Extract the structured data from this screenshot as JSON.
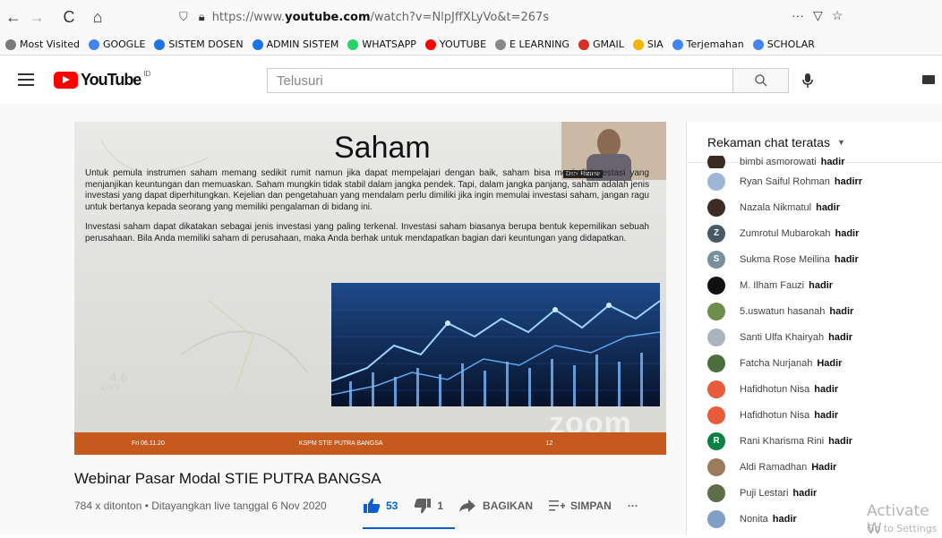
{
  "browser": {
    "back": "←",
    "forward": "→",
    "reload": "C",
    "home": "⌂",
    "url_prefix": "https://www.",
    "url_domain": "youtube.com",
    "url_suffix": "/watch?v=NlpJffXLyVo&t=267s",
    "menu": "···",
    "pocket": "▽",
    "star": "☆"
  },
  "bookmarks": [
    {
      "label": "Most Visited",
      "color": "#7a7a7a"
    },
    {
      "label": "GOOGLE",
      "color": "#4285f4"
    },
    {
      "label": "SISTEM DOSEN",
      "color": "#1a73e8"
    },
    {
      "label": "ADMIN SISTEM",
      "color": "#1a73e8"
    },
    {
      "label": "WHATSAPP",
      "color": "#25d366"
    },
    {
      "label": "YOUTUBE",
      "color": "#ff0000"
    },
    {
      "label": "E LEARNING",
      "color": "#888888"
    },
    {
      "label": "GMAIL",
      "color": "#d93025"
    },
    {
      "label": "SIA",
      "color": "#f4b400"
    },
    {
      "label": "Terjemahan",
      "color": "#4285f4"
    },
    {
      "label": "SCHOLAR",
      "color": "#4285f4"
    }
  ],
  "youtube": {
    "logo_text": "YouTube",
    "logo_region": "ID",
    "search_placeholder": "Telusuri"
  },
  "video": {
    "slide_title": "Saham",
    "slide_p1": "Untuk pemula instrumen saham memang sedikit rumit namun jika dapat mempelajari dengan baik, saham bisa menjadi investasi yang menjanjikan keuntungan dan memuaskan. Saham mungkin tidak stabil dalam jangka pendek. Tapi, dalam jangka panjang, saham adalah jenis investasi yang dapat diperhitungkan. Kejelian dan pengetahuan yang mendalam perlu dimiliki jika ingin memulai investasi saham, jangan ragu untuk bertanya kepada seorang yang memiliki pengalaman di bidang ini.",
    "slide_p2": "Investasi saham dapat dikatakan sebagai jenis investasi yang paling terkenal. Investasi saham biasanya berupa bentuk kepemilikan sebuah perusahaan. Bila Anda memiliki saham di perusahaan, maka Anda berhak untuk mendapatkan bagian dari keuntungan yang didapatkan.",
    "webcam_name": "Dani Rizana",
    "zoom_watermark": "zoom",
    "footer_date": "Fri 06.11.20",
    "footer_center": "KSPM STIE PUTRA BANGSA",
    "footer_page": "12",
    "title": "Webinar Pasar Modal STIE PUTRA BANGSA",
    "meta": "784 x ditonton • Ditayangkan live tanggal 6 Nov 2020",
    "likes": "53",
    "dislikes": "1",
    "share": "BAGIKAN",
    "save": "SIMPAN",
    "more": "···"
  },
  "chat": {
    "header": "Rekaman chat teratas",
    "items": [
      {
        "author": "bimbi asmorowati",
        "msg": "hadir",
        "avatar_color": "#3b2a22",
        "avatar_text": ""
      },
      {
        "author": "Ryan Saiful Rohman",
        "msg": "hadirr",
        "avatar_color": "#9fb6d8",
        "avatar_text": ""
      },
      {
        "author": "Nazala Nikmatul",
        "msg": "hadir",
        "avatar_color": "#3d2b24",
        "avatar_text": ""
      },
      {
        "author": "Zumrotul Mubarokah",
        "msg": "hadir",
        "avatar_color": "#455a64",
        "avatar_text": "Z"
      },
      {
        "author": "Sukma Rose Meilina",
        "msg": "hadir",
        "avatar_color": "#78909c",
        "avatar_text": "S"
      },
      {
        "author": "M. Ilham Fauzi",
        "msg": "hadir",
        "avatar_color": "#111111",
        "avatar_text": ""
      },
      {
        "author": "5.uswatun hasanah",
        "msg": "hadir",
        "avatar_color": "#6b8f4a",
        "avatar_text": ""
      },
      {
        "author": "Santi Ulfa Khairyah",
        "msg": "hadir",
        "avatar_color": "#a9b4bf",
        "avatar_text": ""
      },
      {
        "author": "Fatcha Nurjanah",
        "msg": "Hadir",
        "avatar_color": "#4b6e3c",
        "avatar_text": ""
      },
      {
        "author": "Hafidhotun Nisa",
        "msg": "hadir",
        "avatar_color": "#e65c3c",
        "avatar_text": ""
      },
      {
        "author": "Hafidhotun Nisa",
        "msg": "hadir",
        "avatar_color": "#e65c3c",
        "avatar_text": ""
      },
      {
        "author": "Rani Kharisma Rini",
        "msg": "hadir",
        "avatar_color": "#0b8043",
        "avatar_text": "R"
      },
      {
        "author": "Aldi Ramadhan",
        "msg": "Hadir",
        "avatar_color": "#9b7b5b",
        "avatar_text": ""
      },
      {
        "author": "Puji Lestari",
        "msg": "hadir",
        "avatar_color": "#5d6e4a",
        "avatar_text": ""
      },
      {
        "author": "Nonita",
        "msg": "hadir",
        "avatar_color": "#7ea0c8",
        "avatar_text": ""
      }
    ]
  },
  "os_watermark": {
    "line1": "Activate W",
    "line2": "Go to Settings"
  }
}
